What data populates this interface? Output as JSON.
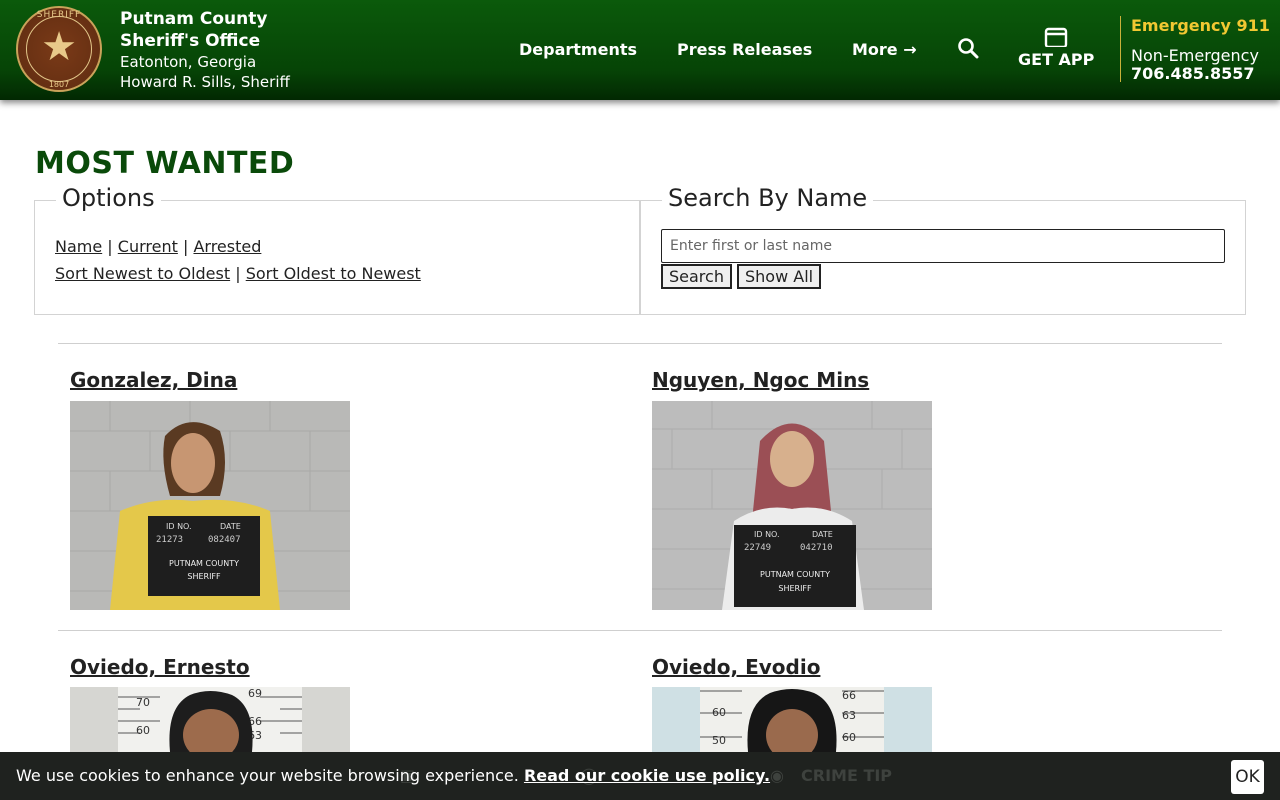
{
  "header": {
    "seal": {
      "top_text": "SHERIFF",
      "year": "1807",
      "side_left": "PUTNAM",
      "side_right": "COUNTY"
    },
    "org_name": "Putnam County Sheriff's Office",
    "city": "Eatonton, Georgia",
    "sheriff": "Howard R. Sills, Sheriff",
    "nav": {
      "departments": "Departments",
      "press_releases": "Press Releases",
      "more": "More →",
      "get_app": "GET APP"
    },
    "emergency": "Emergency 911",
    "non_emergency_label": "Non-Emergency",
    "non_emergency_number": "706.485.8557"
  },
  "page_title": "MOST WANTED",
  "options": {
    "legend": "Options",
    "sort_links": [
      "Name",
      "Current",
      "Arrested"
    ],
    "order_links": [
      "Sort Newest to Oldest",
      "Sort Oldest to Newest"
    ],
    "separator": "|"
  },
  "search": {
    "legend": "Search By Name",
    "placeholder": "Enter first or last name",
    "value": "",
    "search_button": "Search",
    "show_all_button": "Show All"
  },
  "wanted": [
    {
      "name": "Gonzalez, Dina",
      "sign": {
        "id_no": "21273",
        "date": "082407",
        "agency": "PUTNAM COUNTY",
        "office": "SHERIFF",
        "id_label": "ID NO.",
        "date_label": "DATE"
      }
    },
    {
      "name": "Nguyen, Ngoc Mins",
      "sign": {
        "id_no": "22749",
        "date": "042710",
        "agency": "PUTNAM COUNTY",
        "office": "SHERIFF",
        "id_label": "ID NO.",
        "date_label": "DATE"
      }
    },
    {
      "name": "Oviedo, Ernesto",
      "height_marks": [
        "70",
        "69",
        "66",
        "63",
        "60"
      ]
    },
    {
      "name": "Oviedo, Evodio",
      "height_marks": [
        "60",
        "66",
        "63",
        "50",
        "60"
      ]
    }
  ],
  "cookie": {
    "message": "We use cookies to enhance your website browsing experience.",
    "link": "Read our cookie use policy.",
    "ok": "OK",
    "ghost_tip": "CRIME TIP"
  },
  "colors": {
    "header_green": "#064406",
    "title_green": "#0a4a0a",
    "emergency_yellow": "#f2c832",
    "cookie_bg": "#1f221f"
  }
}
